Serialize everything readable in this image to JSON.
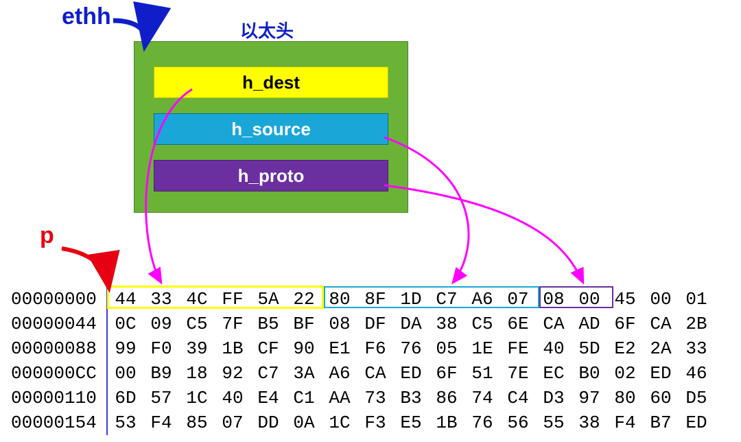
{
  "labels": {
    "ethh": "ethh",
    "title": "以太头",
    "p": "p"
  },
  "fields": {
    "h_dest": "h_dest",
    "h_source": "h_source",
    "h_proto": "h_proto"
  },
  "colors": {
    "struct_bg": "#6ab336",
    "h_dest": "#ffff00",
    "h_source": "#1aa7d8",
    "h_proto": "#6b2fa0",
    "ethh_label": "#0f1ec9",
    "p_label": "#e60012",
    "arrow_ethh": "#0f1ec9",
    "arrow_p": "#e60012",
    "arrow_field": "#ff00ff"
  },
  "highlight": {
    "h_dest": {
      "row": 0,
      "start": 0,
      "end": 5
    },
    "h_source": {
      "row": 0,
      "start": 6,
      "end": 11
    },
    "h_proto": {
      "row": 0,
      "start": 12,
      "end": 13
    }
  },
  "hex": {
    "offsets": [
      "00000000",
      "00000044",
      "00000088",
      "000000CC",
      "00000110",
      "00000154"
    ],
    "rows": [
      [
        "44",
        "33",
        "4C",
        "FF",
        "5A",
        "22",
        "80",
        "8F",
        "1D",
        "C7",
        "A6",
        "07",
        "08",
        "00",
        "45",
        "00",
        "01"
      ],
      [
        "0C",
        "09",
        "C5",
        "7F",
        "B5",
        "BF",
        "08",
        "DF",
        "DA",
        "38",
        "C5",
        "6E",
        "CA",
        "AD",
        "6F",
        "CA",
        "2B"
      ],
      [
        "99",
        "F0",
        "39",
        "1B",
        "CF",
        "90",
        "E1",
        "F6",
        "76",
        "05",
        "1E",
        "FE",
        "40",
        "5D",
        "E2",
        "2A",
        "33"
      ],
      [
        "00",
        "B9",
        "18",
        "92",
        "C7",
        "3A",
        "A6",
        "CA",
        "ED",
        "6F",
        "51",
        "7E",
        "EC",
        "B0",
        "02",
        "ED",
        "46"
      ],
      [
        "6D",
        "57",
        "1C",
        "40",
        "E4",
        "C1",
        "AA",
        "73",
        "B3",
        "86",
        "74",
        "C4",
        "D3",
        "97",
        "80",
        "60",
        "D5"
      ],
      [
        "53",
        "F4",
        "85",
        "07",
        "DD",
        "0A",
        "1C",
        "F3",
        "E5",
        "1B",
        "76",
        "56",
        "55",
        "38",
        "F4",
        "B7",
        "ED"
      ]
    ]
  }
}
